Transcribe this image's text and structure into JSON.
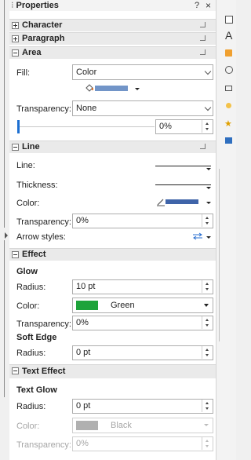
{
  "panel": {
    "title": "Properties",
    "help": "?",
    "close": "×"
  },
  "sections": {
    "character": "Character",
    "paragraph": "Paragraph",
    "area": "Area",
    "line": "Line",
    "effect": "Effect",
    "text_effect": "Text Effect"
  },
  "area": {
    "fill_label": "Fill:",
    "fill_value": "Color",
    "fill_color": "#7295c8",
    "transparency_label": "Transparency:",
    "transparency_value": "None",
    "transparency_percent": "0%"
  },
  "line": {
    "line_label": "Line:",
    "thickness_label": "Thickness:",
    "color_label": "Color:",
    "line_color": "#3f64a9",
    "transparency_label": "Transparency:",
    "transparency_value": "0%",
    "arrow_label": "Arrow styles:"
  },
  "effect": {
    "glow_heading": "Glow",
    "radius_label": "Radius:",
    "radius_value": "10 pt",
    "color_label": "Color:",
    "color_name": "Green",
    "color_hex": "#1ea33a",
    "transparency_label": "Transparency:",
    "transparency_value": "0%",
    "soft_edge_heading": "Soft Edge",
    "soft_radius_label": "Radius:",
    "soft_radius_value": "0 pt"
  },
  "text_effect": {
    "text_glow_heading": "Text Glow",
    "radius_label": "Radius:",
    "radius_value": "0 pt",
    "color_label": "Color:",
    "color_name": "Black",
    "color_hex": "#b0b0b0",
    "transparency_label": "Transparency:",
    "transparency_value": "0%"
  },
  "right_sidebar": {
    "letter": "A"
  }
}
